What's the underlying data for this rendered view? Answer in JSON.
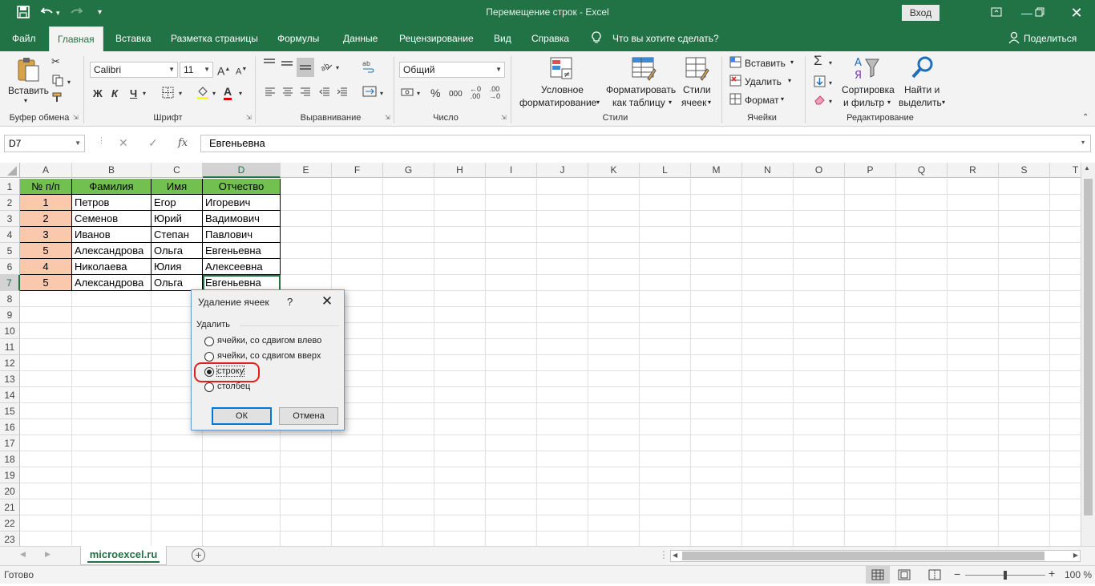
{
  "title_bar": {
    "window_title": "Перемещение строк  -  Excel",
    "signin_label": "Вход",
    "qat_icons": [
      "save-icon",
      "undo-icon",
      "redo-icon",
      "customize-qat-icon"
    ],
    "window_buttons": [
      "ribbon-display-icon",
      "minimize-icon",
      "restore-icon",
      "close-icon"
    ]
  },
  "menu": {
    "tabs": [
      "Файл",
      "Главная",
      "Вставка",
      "Разметка страницы",
      "Формулы",
      "Данные",
      "Рецензирование",
      "Вид",
      "Справка"
    ],
    "active_tab": "Главная",
    "tell_me": "Что вы хотите сделать?",
    "share": "Поделиться"
  },
  "ribbon": {
    "clipboard": {
      "paste": "Вставить",
      "label": "Буфер обмена"
    },
    "font": {
      "name": "Calibri",
      "size": "11",
      "bold": "Ж",
      "italic": "К",
      "underline": "Ч",
      "grow": "A",
      "shrink": "A",
      "label": "Шрифт"
    },
    "alignment": {
      "label": "Выравнивание"
    },
    "number": {
      "format": "Общий",
      "percent": "%",
      "thousands": "000",
      "label": "Число"
    },
    "styles": {
      "conditional_1": "Условное",
      "conditional_2": "форматирование",
      "table_1": "Форматировать",
      "table_2": "как таблицу",
      "cell_1": "Стили",
      "cell_2": "ячеек",
      "label": "Стили"
    },
    "cells": {
      "insert": "Вставить",
      "delete": "Удалить",
      "format": "Формат",
      "label": "Ячейки"
    },
    "editing": {
      "sort_1": "Сортировка",
      "sort_2": "и фильтр",
      "find_1": "Найти и",
      "find_2": "выделить",
      "label": "Редактирование"
    }
  },
  "formula_bar": {
    "name_box": "D7",
    "fx": "fx",
    "formula": "Евгеньевна"
  },
  "sheet": {
    "columns": [
      "A",
      "B",
      "C",
      "D",
      "E",
      "F",
      "G",
      "H",
      "I",
      "J",
      "K",
      "L",
      "M",
      "N",
      "O",
      "P",
      "Q",
      "R",
      "S",
      "T"
    ],
    "selected_column": "D",
    "rows": [
      "1",
      "2",
      "3",
      "4",
      "5",
      "6",
      "7",
      "8",
      "9",
      "10",
      "11",
      "12",
      "13",
      "14",
      "15",
      "16",
      "17",
      "18",
      "19",
      "20",
      "21",
      "22",
      "23"
    ],
    "selected_row": "7",
    "header": [
      "№ п/п",
      "Фамилия",
      "Имя",
      "Отчество"
    ],
    "data": [
      [
        "1",
        "Петров",
        "Егор",
        "Игоревич"
      ],
      [
        "2",
        "Семенов",
        "Юрий",
        "Вадимович"
      ],
      [
        "3",
        "Иванов",
        "Степан",
        "Павлович"
      ],
      [
        "5",
        "Александрова",
        "Ольга",
        "Евгеньевна"
      ],
      [
        "4",
        "Николаева",
        "Юлия",
        "Алексеевна"
      ],
      [
        "5",
        "Александрова",
        "Ольга",
        "Евгеньевна"
      ]
    ],
    "colors": {
      "header_fill": "#71c050",
      "number_fill": "#f9c8ad",
      "accent": "#217346"
    }
  },
  "dialog": {
    "title": "Удаление ячеек",
    "help": "?",
    "group_label": "Удалить",
    "options": [
      {
        "label": "ячейки, со сдвигом влево",
        "selected": false
      },
      {
        "label": "ячейки, со сдвигом вверх",
        "selected": false
      },
      {
        "label": "строку",
        "selected": true
      },
      {
        "label": "столбец",
        "selected": false
      }
    ],
    "ok": "ОК",
    "cancel": "Отмена"
  },
  "sheet_tabs": {
    "active": "microexcel.ru"
  },
  "status": {
    "mode": "Готово",
    "zoom": "100 %"
  }
}
